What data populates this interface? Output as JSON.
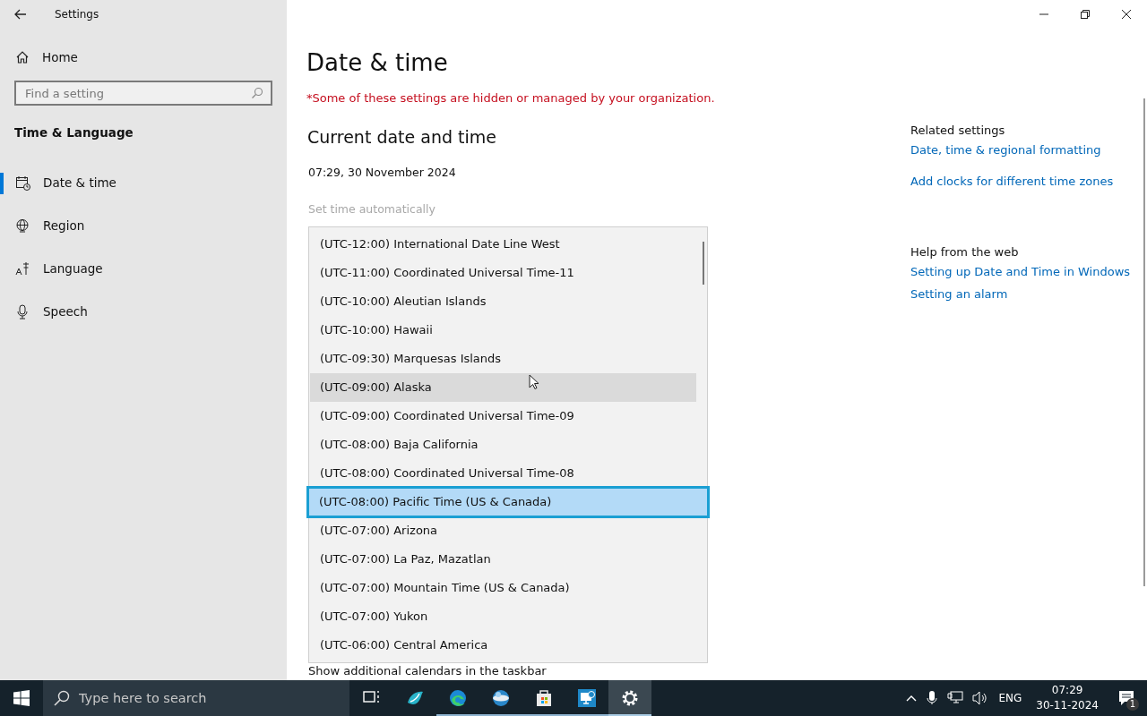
{
  "window": {
    "title": "Settings"
  },
  "sidebar": {
    "home": "Home",
    "search": {
      "placeholder": "Find a setting"
    },
    "section": "Time & Language",
    "items": [
      {
        "label": "Date & time",
        "kind": "calendar",
        "selected": true
      },
      {
        "label": "Region",
        "kind": "globe",
        "selected": false
      },
      {
        "label": "Language",
        "kind": "language",
        "selected": false
      },
      {
        "label": "Speech",
        "kind": "mic",
        "selected": false
      }
    ]
  },
  "main": {
    "title": "Date & time",
    "notice": "*Some of these settings are hidden or managed by your organization.",
    "heading": "Current date and time",
    "current_datetime": "07:29, 30 November 2024",
    "set_time_automatically": {
      "label": "Set time automatically",
      "disabled": true
    },
    "timezone_list": {
      "options": [
        {
          "label": "(UTC-12:00) International Date Line West",
          "selected": false,
          "hovered": false
        },
        {
          "label": "(UTC-11:00) Coordinated Universal Time-11",
          "selected": false,
          "hovered": false
        },
        {
          "label": "(UTC-10:00) Aleutian Islands",
          "selected": false,
          "hovered": false
        },
        {
          "label": "(UTC-10:00) Hawaii",
          "selected": false,
          "hovered": false
        },
        {
          "label": "(UTC-09:30) Marquesas Islands",
          "selected": false,
          "hovered": false
        },
        {
          "label": "(UTC-09:00) Alaska",
          "selected": false,
          "hovered": true
        },
        {
          "label": "(UTC-09:00) Coordinated Universal Time-09",
          "selected": false,
          "hovered": false
        },
        {
          "label": "(UTC-08:00) Baja California",
          "selected": false,
          "hovered": false
        },
        {
          "label": "(UTC-08:00) Coordinated Universal Time-08",
          "selected": false,
          "hovered": false
        },
        {
          "label": "(UTC-08:00) Pacific Time (US & Canada)",
          "selected": true,
          "hovered": false
        },
        {
          "label": "(UTC-07:00) Arizona",
          "selected": false,
          "hovered": false
        },
        {
          "label": "(UTC-07:00) La Paz, Mazatlan",
          "selected": false,
          "hovered": false
        },
        {
          "label": "(UTC-07:00) Mountain Time (US & Canada)",
          "selected": false,
          "hovered": false
        },
        {
          "label": "(UTC-07:00) Yukon",
          "selected": false,
          "hovered": false
        },
        {
          "label": "(UTC-06:00) Central America",
          "selected": false,
          "hovered": false
        }
      ]
    },
    "show_calendars_label": "Show additional calendars in the taskbar"
  },
  "related_settings": {
    "heading": "Related settings",
    "links": [
      "Date, time & regional formatting",
      "Add clocks for different time zones"
    ]
  },
  "help_from_web": {
    "heading": "Help from the web",
    "links": [
      "Setting up Date and Time in Windows",
      "Setting an alarm"
    ]
  },
  "taskbar": {
    "search_placeholder": "Type here to search",
    "apps": [
      {
        "kind": "taskview",
        "running": false,
        "active": false
      },
      {
        "kind": "bird",
        "running": false,
        "active": false
      },
      {
        "kind": "edge",
        "running": true,
        "active": false
      },
      {
        "kind": "sphere",
        "running": true,
        "active": false
      },
      {
        "kind": "store",
        "running": true,
        "active": false
      },
      {
        "kind": "monitor",
        "running": true,
        "active": false
      },
      {
        "kind": "gear",
        "running": true,
        "active": true
      }
    ],
    "tray": {
      "language": "ENG",
      "time": "07:29",
      "date": "30-11-2024",
      "notification_count": "1"
    }
  }
}
